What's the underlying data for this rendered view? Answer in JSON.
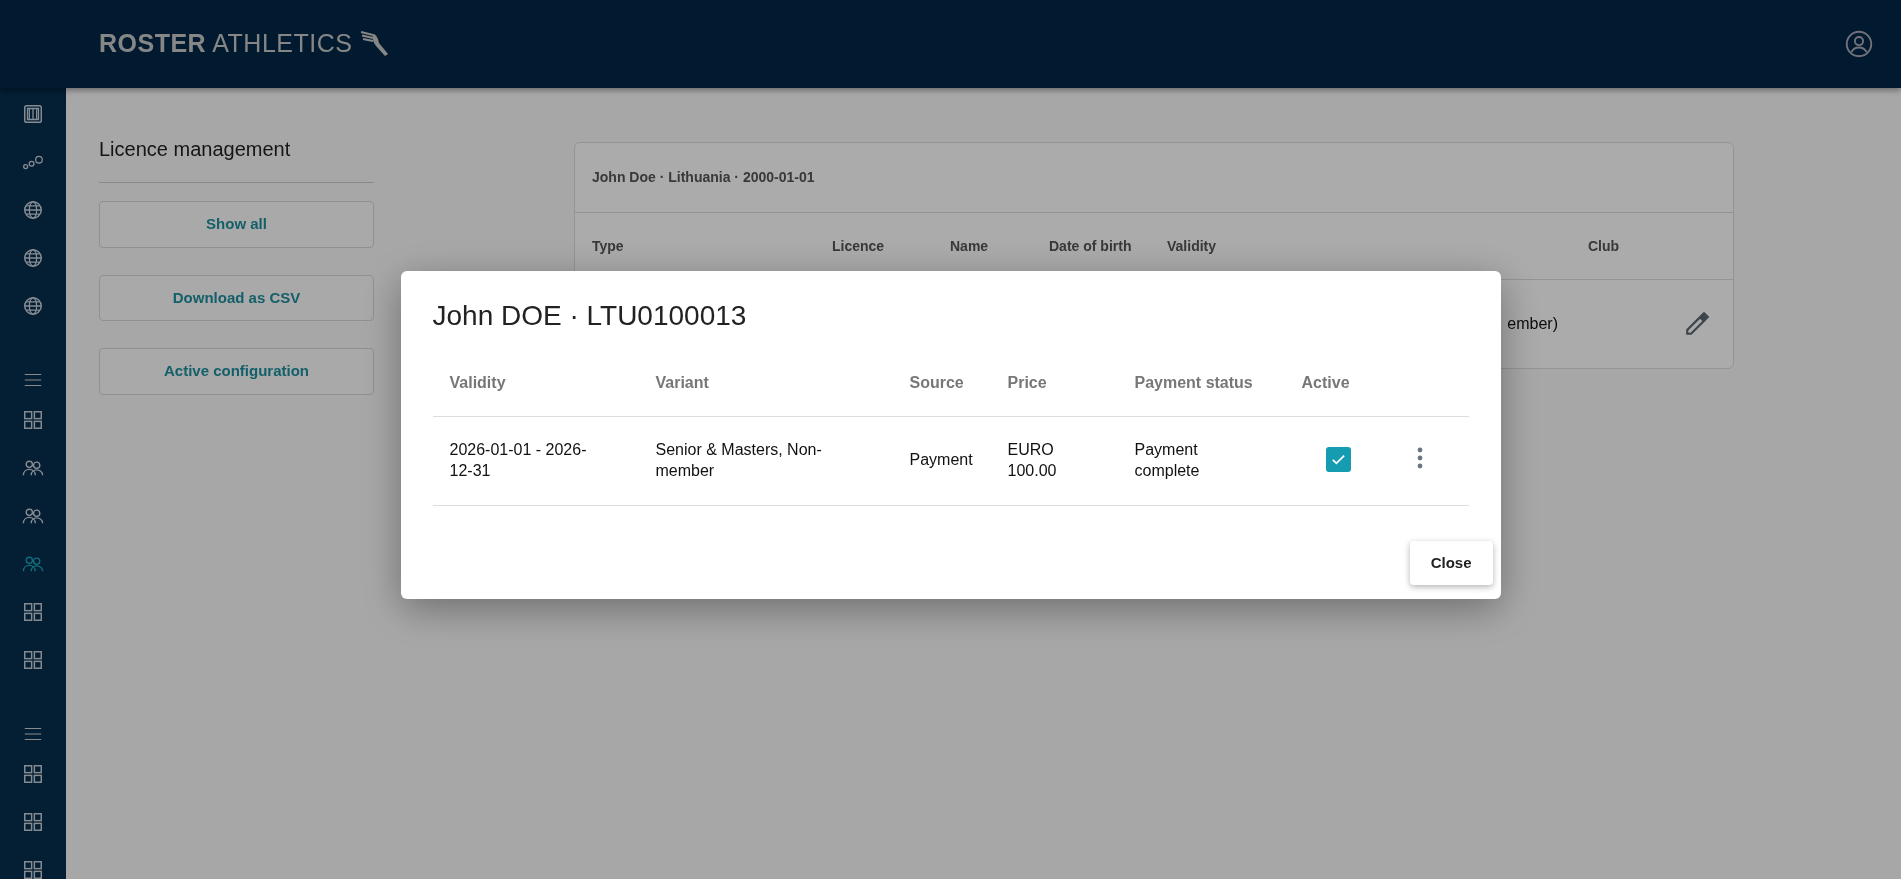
{
  "header": {
    "logo": {
      "bold": "ROSTER",
      "light": "ATHLETICS"
    }
  },
  "sidebar": {
    "items": [
      {
        "kind": "board",
        "selected": false
      },
      {
        "kind": "nodes",
        "selected": false
      },
      {
        "kind": "globe",
        "selected": false
      },
      {
        "kind": "globe",
        "selected": false
      },
      {
        "kind": "globe",
        "selected": false
      },
      {
        "kind": "menu",
        "selected": false
      },
      {
        "kind": "grid",
        "selected": false
      },
      {
        "kind": "people",
        "selected": false
      },
      {
        "kind": "people",
        "selected": false
      },
      {
        "kind": "people",
        "selected": true
      },
      {
        "kind": "grid",
        "selected": false
      },
      {
        "kind": "grid",
        "selected": false
      },
      {
        "kind": "menu",
        "selected": false
      },
      {
        "kind": "grid",
        "selected": false
      },
      {
        "kind": "grid",
        "selected": false
      },
      {
        "kind": "grid",
        "selected": false
      }
    ]
  },
  "panel": {
    "title": "Licence management",
    "buttons": [
      "Show all",
      "Download as CSV",
      "Active configuration"
    ]
  },
  "athlete_card": {
    "subtitle": "John Doe · Lithuania · 2000-01-01",
    "columns": [
      "Type",
      "Licence",
      "Name",
      "Date of birth",
      "Validity",
      "Club"
    ],
    "row": {
      "partial_text": "ember)"
    }
  },
  "modal": {
    "title": "John DOE · LTU0100013",
    "columns": [
      "Validity",
      "Variant",
      "Source",
      "Price",
      "Payment status",
      "Active"
    ],
    "rows": [
      {
        "validity": "2026-01-01 - 2026-12-31",
        "variant": "Senior & Masters, Non-member",
        "source": "Payment",
        "price": "EURO 100.00",
        "payment_status": "Payment complete",
        "active": true
      }
    ],
    "close_button": "Close"
  }
}
